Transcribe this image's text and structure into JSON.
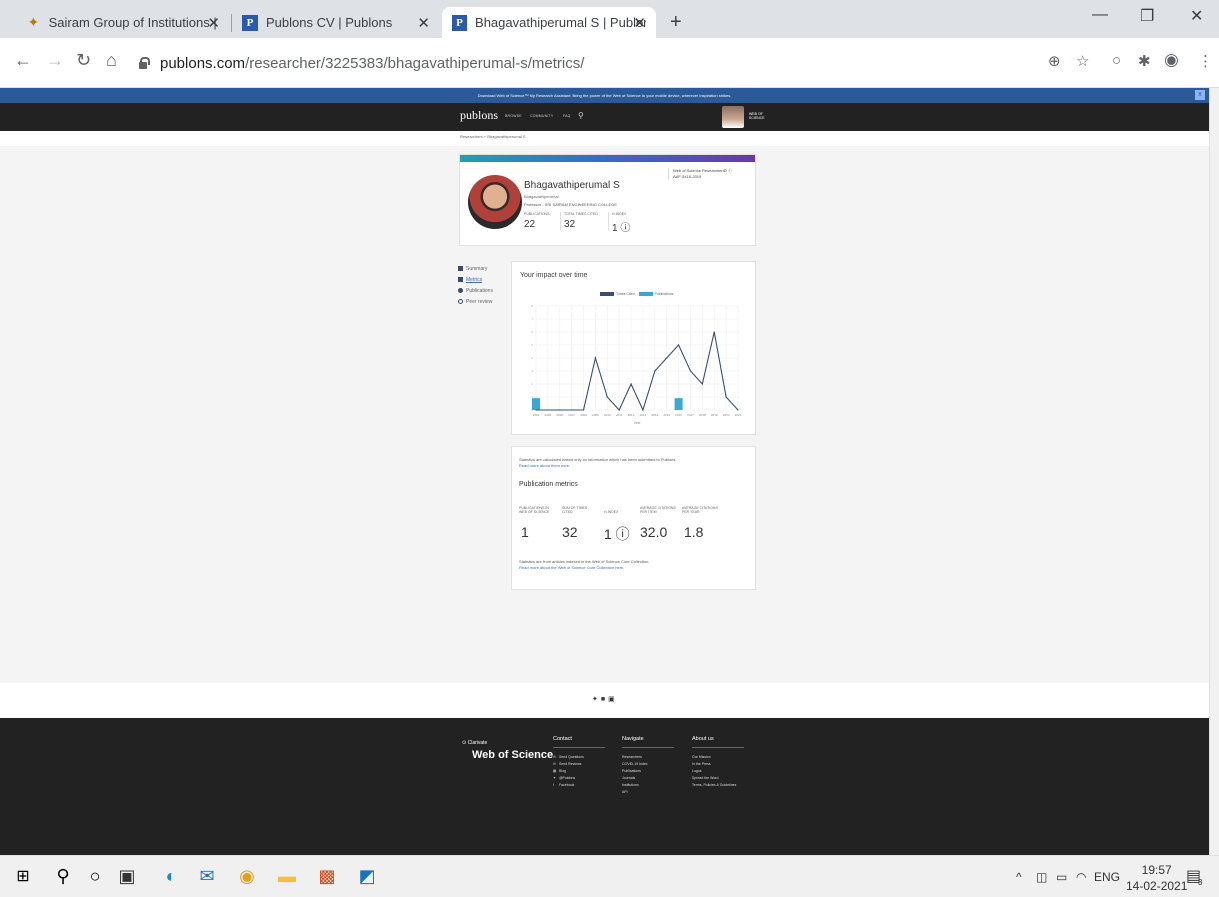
{
  "browser": {
    "tabs": [
      {
        "title": "Sairam Group of Institutions | Sri",
        "icon": "sairam-favicon"
      },
      {
        "title": "Publons CV | Publons",
        "icon": "publons-favicon"
      },
      {
        "title": "Bhagavathiperumal S | Publons",
        "icon": "publons-favicon"
      }
    ],
    "url_host": "publons.com",
    "url_path": "/researcher/3225383/bhagavathiperumal-s/metrics/"
  },
  "page": {
    "banner": "Download Web of Science™ My Research Assistant: Bring the power of the Web of Science to your mobile device, wherever inspiration strikes.",
    "logo": "publons",
    "nav": [
      "BROWSE",
      "COMMUNITY",
      "FAQ"
    ],
    "wos_mini": [
      "WEB OF",
      "SCIENCE"
    ],
    "breadcrumb": "Researchers  >  Bhagavathiperumal S",
    "profile": {
      "name": "Bhagavathiperumal S",
      "subtitle": "Bhagavathiperumal",
      "role": "Professor - SRI SAIRAM ENGINEERING COLLEGE",
      "stats": [
        {
          "label": "PUBLICATIONS",
          "value": "22"
        },
        {
          "label": "TOTAL TIMES CITED",
          "value": "32"
        },
        {
          "label": "H-INDEX",
          "value": "1 ⓘ"
        }
      ],
      "wos_label": "Web of Science ResearcherID ⓘ",
      "wos_id": "AAF-5416-2019"
    },
    "sidenav": [
      {
        "label": "Summary",
        "icon": "grid-icon"
      },
      {
        "label": "Metrics",
        "icon": "chart-icon"
      },
      {
        "label": "Publications",
        "icon": "publications-icon"
      },
      {
        "label": "Peer review",
        "icon": "magnifier-icon"
      }
    ],
    "chart": {
      "title": "Your impact over time",
      "legend": [
        "Times Cited",
        "Publications"
      ],
      "x_label": "Year",
      "colors": {
        "line": "#3a4f70",
        "bars": "#3aa8d0"
      }
    },
    "metrics": {
      "intro_1": "Statistics are calculated based only on information which has been submitted to Publons.",
      "intro_2": "Read more about them here.",
      "heading": "Publication metrics",
      "items": [
        {
          "label": "PUBLICATIONS IN WEB OF SCIENCE",
          "value": "1"
        },
        {
          "label": "SUM OF TIMES CITED",
          "value": "32"
        },
        {
          "label": "H-INDEX",
          "value": "1 ⓘ"
        },
        {
          "label": "AVERAGE CITATIONS PER ITEM",
          "value": "32.0"
        },
        {
          "label": "AVERAGE CITATIONS PER YEAR",
          "value": "1.8"
        }
      ],
      "note_1": "Statistics are from articles indexed in the Web of Science Core Collection.",
      "note_2": "Read more about the Web of Science Core Collection here."
    },
    "social_icons": [
      "twitter-icon",
      "facebook-icon",
      "linkedin-icon"
    ],
    "footer": {
      "brand_small": "Clarivate",
      "brand_big": "Web of Science",
      "columns": [
        {
          "heading": "Contact",
          "items": [
            "Send Questions",
            "Send Reviews",
            "Blog",
            "@Publons",
            "Facebook"
          ]
        },
        {
          "heading": "Navigate",
          "items": [
            "Researchers",
            "COVID-19 Index",
            "Publications",
            "Journals",
            "Institutions",
            "API"
          ]
        },
        {
          "heading": "About us",
          "items": [
            "Our Mission",
            "In the Press",
            "Logos",
            "Spread the Word",
            "Terms, Policies & Guidelines"
          ]
        }
      ]
    }
  },
  "chart_data": {
    "type": "line",
    "title": "Your impact over time",
    "x": [
      "2004",
      "2005",
      "2006",
      "2007",
      "2008",
      "2009",
      "2010",
      "2011",
      "2012",
      "2013",
      "2014",
      "2015",
      "2016",
      "2017",
      "2018",
      "2019",
      "2020",
      "2021"
    ],
    "series": [
      {
        "name": "Times Cited",
        "values": [
          0,
          0,
          0,
          0,
          0,
          4,
          1,
          0,
          2,
          0,
          3,
          4,
          5,
          3,
          2,
          6,
          1,
          0
        ]
      },
      {
        "name": "Publications",
        "values": [
          1,
          0,
          0,
          0,
          0,
          0,
          0,
          0,
          0,
          0,
          0,
          0,
          1,
          0,
          0,
          0,
          0,
          0
        ]
      }
    ],
    "xlabel": "Year",
    "ylim": [
      0,
      8
    ]
  },
  "taskbar": {
    "apps": [
      "windows-start-icon",
      "search-icon",
      "cortana-icon",
      "store-icon",
      "edge-icon",
      "mail-icon",
      "chrome-icon",
      "file-explorer-icon",
      "powerpoint-icon",
      "photos-icon"
    ],
    "lang": "ENG",
    "time": "19:57",
    "date": "14-02-2021",
    "notifications": "3"
  }
}
